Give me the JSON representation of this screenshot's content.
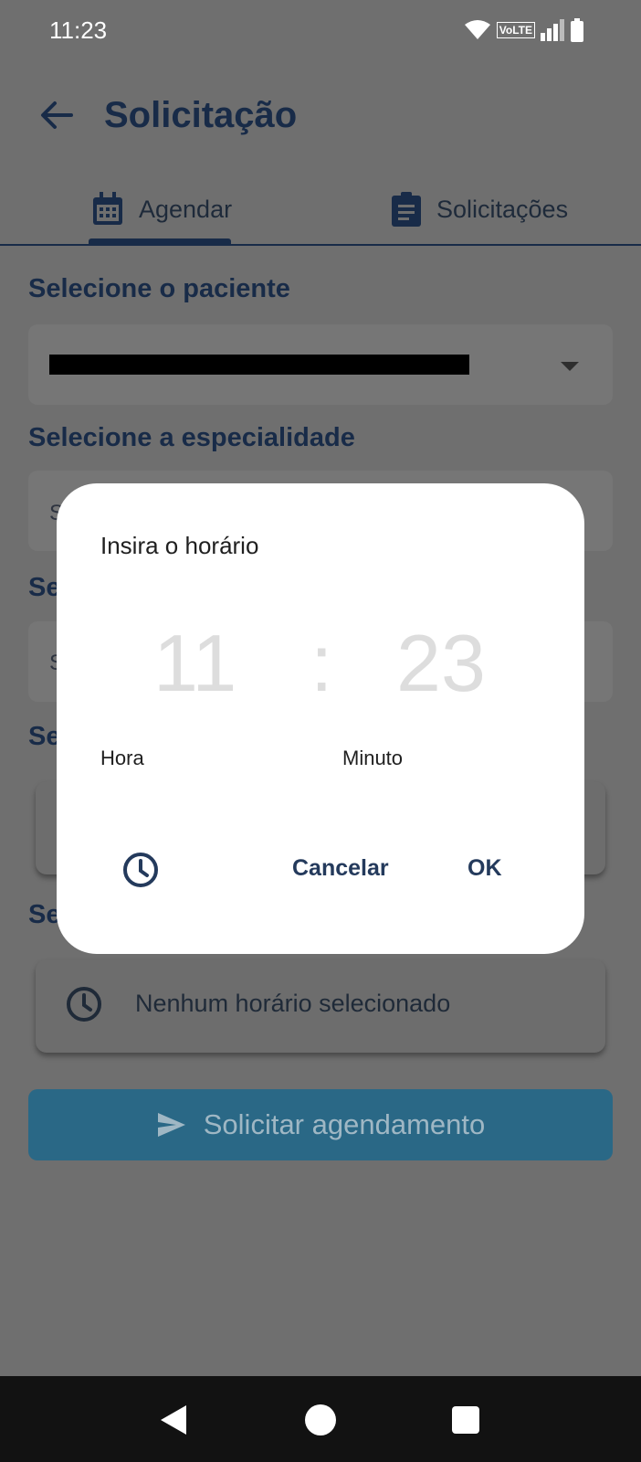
{
  "status_bar": {
    "time": "11:23",
    "network": "VoLTE"
  },
  "app_bar": {
    "title": "Solicitação",
    "back_icon": "arrow-left-icon"
  },
  "tabs": [
    {
      "label": "Agendar",
      "icon": "calendar-icon",
      "selected": true
    },
    {
      "label": "Solicitações",
      "icon": "clipboard-icon",
      "selected": false
    }
  ],
  "form": {
    "patient_label": "Selecione o paciente",
    "specialty_label": "Selecione a especialidade",
    "specialty_hint_partial": "S",
    "third_label_partial": "Se",
    "third_hint_partial": "S",
    "fourth_label_partial": "Se",
    "fifth_label_partial": "Se",
    "time_card_text": "Nenhum horário selecionado",
    "submit_label": "Solicitar agendamento"
  },
  "dialog": {
    "title": "Insira o horário",
    "hour": "11",
    "minute": "23",
    "separator": ":",
    "hour_label": "Hora",
    "minute_label": "Minuto",
    "cancel_label": "Cancelar",
    "ok_label": "OK"
  },
  "colors": {
    "primary": "#182b48",
    "button": "#2a6886",
    "dialog_bg": "#ffffff",
    "scrim": "#6f6f6f"
  }
}
